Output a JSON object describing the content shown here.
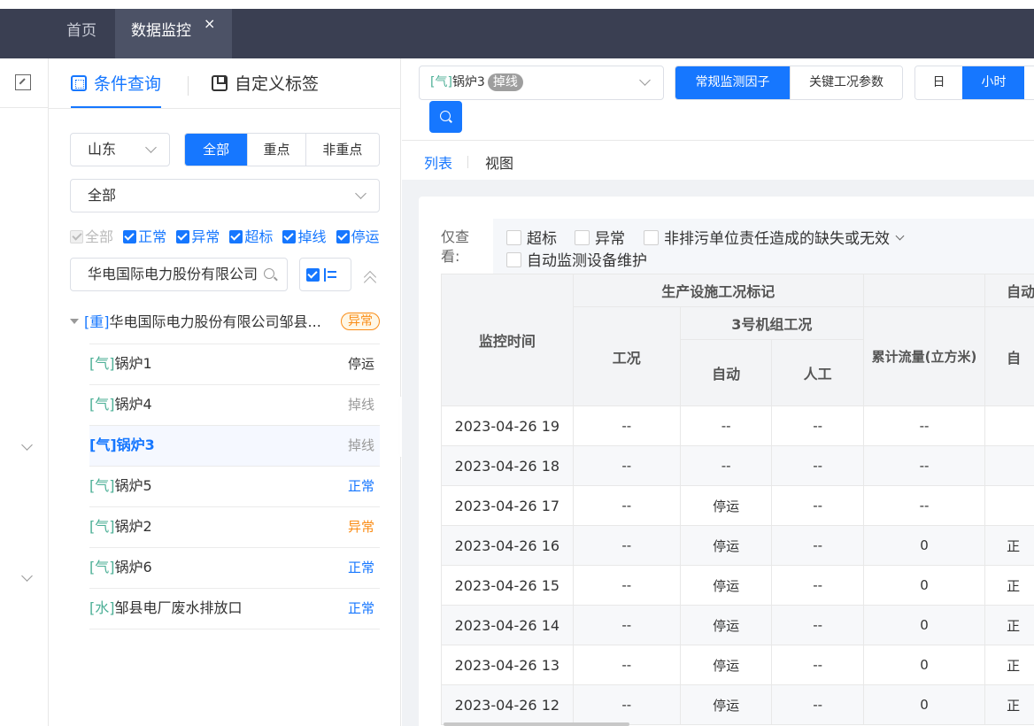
{
  "tabs": {
    "home": "首页",
    "active": "数据监控",
    "close": "×"
  },
  "sidebar": {
    "tab_query": "条件查询",
    "tab_tags": "自定义标签",
    "region": "山东",
    "scope_buttons": [
      "全部",
      "重点",
      "非重点"
    ],
    "scope_selected": "全部",
    "category": "全部",
    "status_filters": [
      {
        "label": "全部",
        "checked": true,
        "disabled": true
      },
      {
        "label": "正常",
        "checked": true
      },
      {
        "label": "异常",
        "checked": true
      },
      {
        "label": "超标",
        "checked": true
      },
      {
        "label": "掉线",
        "checked": true
      },
      {
        "label": "停运",
        "checked": true
      }
    ],
    "search_value": "华电国际电力股份有限公司",
    "tree": {
      "root_prefix": "[重]",
      "root_name": "华电国际电力股份有限公司邹县",
      "root_ellipsis": "...",
      "root_status": "异常",
      "items": [
        {
          "prefix": "[气]",
          "name": "锅炉1",
          "status": "停运",
          "kind": "stop"
        },
        {
          "prefix": "[气]",
          "name": "锅炉4",
          "status": "掉线",
          "kind": "off"
        },
        {
          "prefix": "[气]",
          "name": "锅炉3",
          "status": "掉线",
          "kind": "off",
          "selected": true
        },
        {
          "prefix": "[气]",
          "name": "锅炉5",
          "status": "正常",
          "kind": "ok"
        },
        {
          "prefix": "[气]",
          "name": "锅炉2",
          "status": "异常",
          "kind": "warn"
        },
        {
          "prefix": "[气]",
          "name": "锅炉6",
          "status": "正常",
          "kind": "ok"
        },
        {
          "prefix": "[水]",
          "name": "邹县电厂废水排放口",
          "status": "正常",
          "kind": "ok"
        }
      ]
    }
  },
  "toolbar": {
    "device_prefix": "[气]",
    "device_name": "锅炉3",
    "device_tag": "掉线",
    "factor_buttons": [
      "常规监测因子",
      "关键工况参数"
    ],
    "factor_selected": "常规监测因子",
    "period_buttons": [
      "日",
      "小时"
    ],
    "period_selected": "小时"
  },
  "view_tabs": {
    "list": "列表",
    "view": "视图"
  },
  "filter": {
    "label": "仅查看:",
    "options": [
      "超标",
      "异常",
      "非排污单位责任造成的缺失或无效",
      "自动监测设备维护"
    ]
  },
  "table": {
    "headers": {
      "time": "监控时间",
      "group1": "生产设施工况标记",
      "condition": "工况",
      "unit3": "3号机组工况",
      "auto": "自动",
      "manual": "人工",
      "flow": "累计流量(立方米)",
      "group_partial": "自动",
      "sub_partial": "自"
    },
    "rows": [
      {
        "time": "2023-04-26 19",
        "condition": "--",
        "auto": "--",
        "manual": "--",
        "flow": "--",
        "next": ""
      },
      {
        "time": "2023-04-26 18",
        "condition": "--",
        "auto": "--",
        "manual": "--",
        "flow": "--",
        "next": ""
      },
      {
        "time": "2023-04-26 17",
        "condition": "--",
        "auto": "停运",
        "manual": "--",
        "flow": "--",
        "next": ""
      },
      {
        "time": "2023-04-26 16",
        "condition": "--",
        "auto": "停运",
        "manual": "--",
        "flow": "0",
        "next": "正"
      },
      {
        "time": "2023-04-26 15",
        "condition": "--",
        "auto": "停运",
        "manual": "--",
        "flow": "0",
        "next": "正"
      },
      {
        "time": "2023-04-26 14",
        "condition": "--",
        "auto": "停运",
        "manual": "--",
        "flow": "0",
        "next": "正"
      },
      {
        "time": "2023-04-26 13",
        "condition": "--",
        "auto": "停运",
        "manual": "--",
        "flow": "0",
        "next": "正"
      },
      {
        "time": "2023-04-26 12",
        "condition": "--",
        "auto": "停运",
        "manual": "--",
        "flow": "0",
        "next": "正"
      }
    ]
  }
}
